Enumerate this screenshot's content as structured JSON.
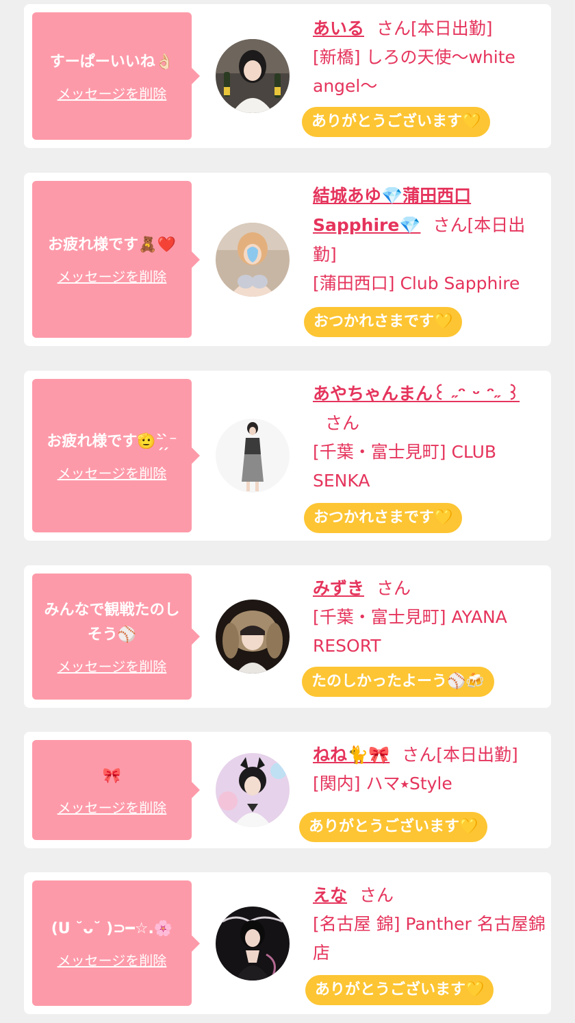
{
  "delete_label": "メッセージを削除",
  "san_label": "さん",
  "cards": [
    {
      "message": "すーぱーいいね👌🏻",
      "name": "あいる",
      "status": "[本日出勤]",
      "shop": "[新橋] しろの天使〜white angel〜",
      "reply": "ありがとうございます💛"
    },
    {
      "message": "お疲れ様です🧸❤️",
      "name": "結城あゆ💎蒲田西口Sapphire💎",
      "status": "[本日出勤]",
      "shop": "[蒲田西口] Club Sapphire",
      "reply": "おつかれさまです💛"
    },
    {
      "message": "お疲れ様です🫡⁻̗̀ ̗̀⁻",
      "name": "あやちゃんまん꒰ ˶ᵔ ᵕ ᵔ˶ ꒱",
      "status": "",
      "shop": "[千葉・富士見町] CLUB SENKA",
      "reply": "おつかれさまです💛"
    },
    {
      "message": "みんなで観戦たのしそう⚾️",
      "name": "みずき",
      "status": "",
      "shop": "[千葉・富士見町] AYANA RESORT",
      "reply": "たのしかったよーう⚾️🍻"
    },
    {
      "message": "🎀",
      "name": "ねね🐈🎀",
      "status": "[本日出勤]",
      "shop": "[関内] ハマ⭑Style",
      "reply": "ありがとうございます💛"
    },
    {
      "message": "(U ˘ᴗ˘ )⊃━☆.🌸",
      "name": "えな",
      "status": "",
      "shop": "[名古屋 錦] Panther 名古屋錦店",
      "reply": "ありがとうございます💛"
    }
  ]
}
